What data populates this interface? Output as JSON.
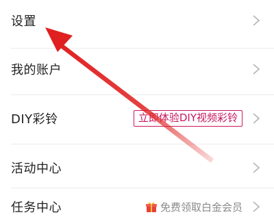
{
  "menu": {
    "items": [
      {
        "label": "设置"
      },
      {
        "label": "我的账户"
      },
      {
        "label": "DIY彩铃",
        "badge": "立即体验DIY视频彩铃"
      },
      {
        "label": "活动中心"
      },
      {
        "label": "任务中心",
        "hint": "免费领取白金会员"
      }
    ]
  },
  "colors": {
    "badge": "#c8175d",
    "arrow": "#e02020",
    "hint_text": "#8a8a8a",
    "label_text": "#222222"
  },
  "icons": {
    "chevron": "chevron-right-icon",
    "gift": "gift-icon",
    "annotation": "red-arrow-icon"
  }
}
